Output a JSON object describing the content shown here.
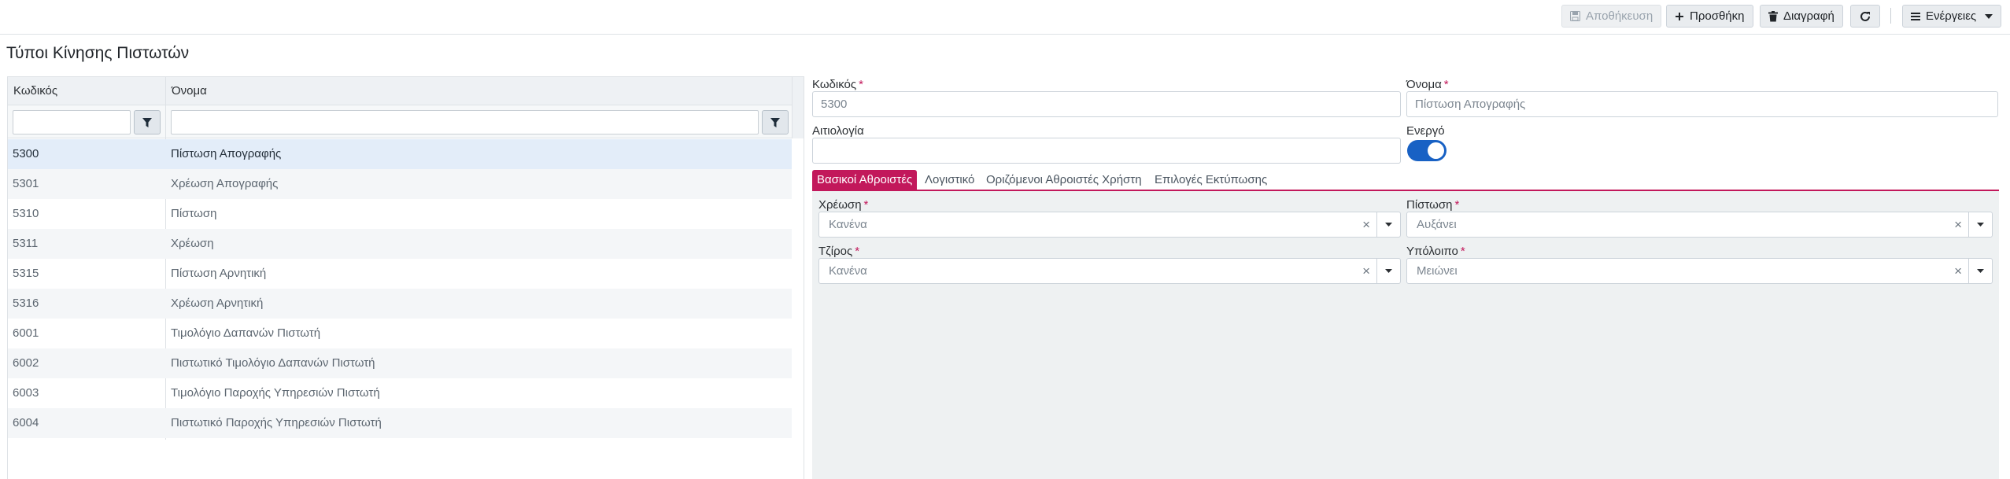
{
  "toolbar": {
    "save_label": "Αποθήκευση",
    "add_label": "Προσθήκη",
    "delete_label": "Διαγραφή",
    "actions_label": "Ενέργειες"
  },
  "page": {
    "title": "Τύποι Κίνησης Πιστωτών"
  },
  "grid": {
    "columns": [
      "Κωδικός",
      "Όνομα"
    ],
    "rows": [
      {
        "code": "5300",
        "name": "Πίστωση Απογραφής",
        "selected": true
      },
      {
        "code": "5301",
        "name": "Χρέωση Απογραφής"
      },
      {
        "code": "5310",
        "name": "Πίστωση"
      },
      {
        "code": "5311",
        "name": "Χρέωση"
      },
      {
        "code": "5315",
        "name": "Πίστωση Αρνητική"
      },
      {
        "code": "5316",
        "name": "Χρέωση Αρνητική"
      },
      {
        "code": "6001",
        "name": "Τιμολόγιο Δαπανών Πιστωτή"
      },
      {
        "code": "6002",
        "name": "Πιστωτικό Τιμολόγιο Δαπανών Πιστωτή"
      },
      {
        "code": "6003",
        "name": "Τιμολόγιο Παροχής Υπηρεσιών Πιστωτή"
      },
      {
        "code": "6004",
        "name": "Πιστωτικό Παροχής Υπηρεσιών Πιστωτή"
      }
    ]
  },
  "form": {
    "code_label": "Κωδικός",
    "code_value": "5300",
    "name_label": "Όνομα",
    "name_value": "Πίστωση Απογραφής",
    "reason_label": "Αιτιολογία",
    "reason_value": "",
    "active_label": "Ενεργό",
    "active": true,
    "required_mark": "*"
  },
  "tabs": [
    "Βασικοί Αθροιστές",
    "Λογιστικό",
    "Οριζόμενοι Αθροιστές Χρήστη",
    "Επιλογές Εκτύπωσης"
  ],
  "totals": {
    "debit_label": "Χρέωση",
    "debit_value": "Κανένα",
    "credit_label": "Πίστωση",
    "credit_value": "Αυξάνει",
    "turnover_label": "Τζίρος",
    "turnover_value": "Κανένα",
    "balance_label": "Υπόλοιπο",
    "balance_value": "Μειώνει",
    "clear_glyph": "×"
  },
  "colors": {
    "accent": "#c2185b",
    "toggle": "#1861c4",
    "selected_row": "#e3edf9"
  }
}
